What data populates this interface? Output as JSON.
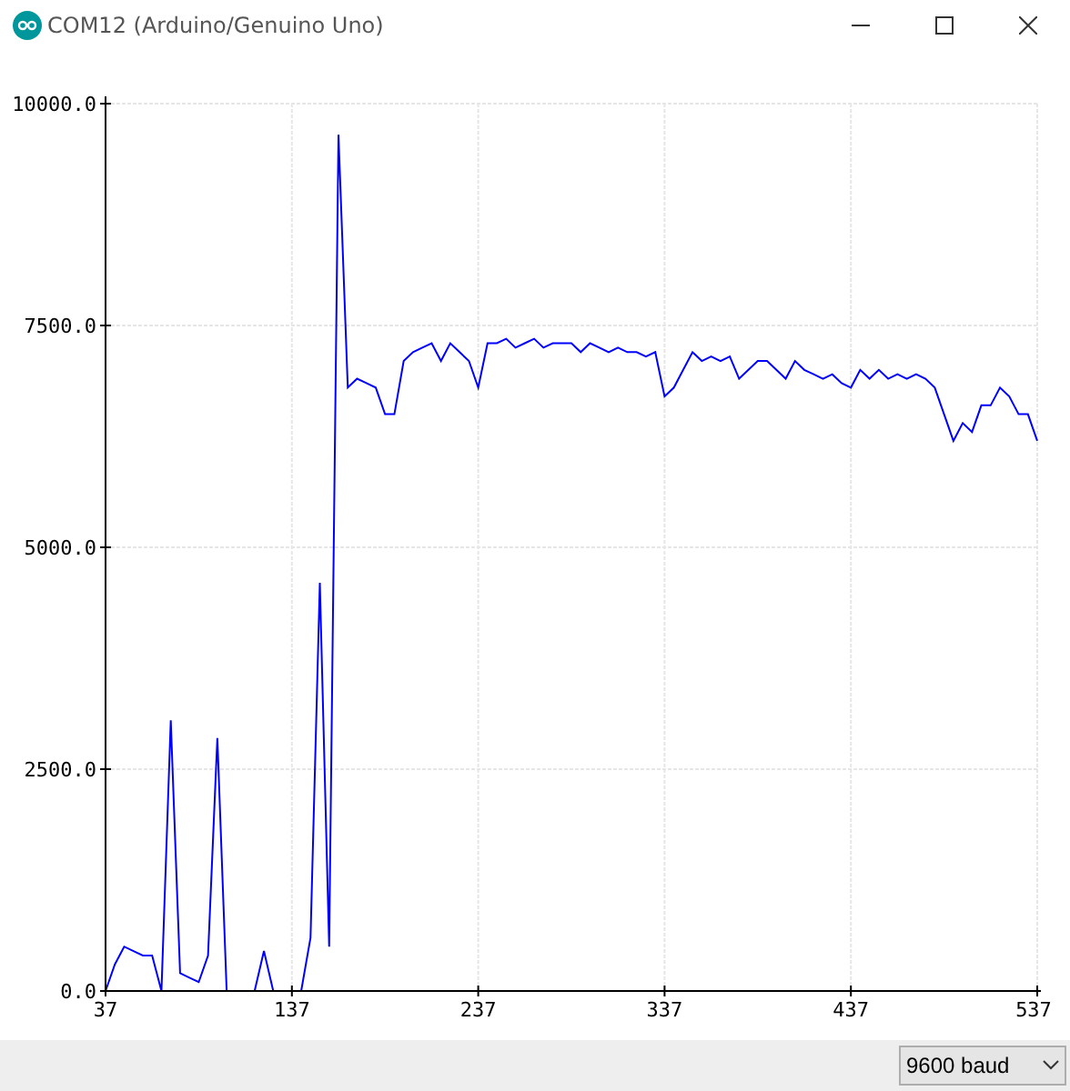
{
  "window": {
    "title": "COM12 (Arduino/Genuino Uno)"
  },
  "plot": {
    "chart_data": {
      "type": "line",
      "x": [
        37,
        42,
        47,
        52,
        57,
        62,
        67,
        72,
        77,
        82,
        87,
        92,
        97,
        102,
        107,
        112,
        117,
        122,
        127,
        132,
        137,
        142,
        147,
        152,
        157,
        162,
        167,
        172,
        177,
        182,
        187,
        192,
        197,
        202,
        207,
        212,
        217,
        222,
        227,
        232,
        237,
        242,
        247,
        252,
        257,
        262,
        267,
        272,
        277,
        282,
        287,
        292,
        297,
        302,
        307,
        312,
        317,
        322,
        327,
        332,
        337,
        342,
        347,
        352,
        357,
        362,
        367,
        372,
        377,
        382,
        387,
        392,
        397,
        402,
        407,
        412,
        417,
        422,
        427,
        432,
        437,
        442,
        447,
        452,
        457,
        462,
        467,
        472,
        477,
        482,
        487,
        492,
        497,
        502,
        507,
        512,
        517,
        522,
        527,
        532,
        537
      ],
      "grid": true,
      "series": [
        {
          "color": "#0000ff",
          "values": [
            0,
            300,
            500,
            450,
            400,
            400,
            0,
            3050,
            200,
            150,
            100,
            400,
            2850,
            0,
            0,
            0,
            0,
            450,
            0,
            0,
            0,
            0,
            600,
            4600,
            500,
            9650,
            6800,
            6900,
            6850,
            6800,
            6500,
            6500,
            7100,
            7200,
            7250,
            7300,
            7100,
            7300,
            7200,
            7100,
            6800,
            7300,
            7300,
            7350,
            7250,
            7300,
            7350,
            7250,
            7300,
            7300,
            7300,
            7200,
            7300,
            7250,
            7200,
            7250,
            7200,
            7200,
            7150,
            7200,
            6700,
            6800,
            7000,
            7200,
            7100,
            7150,
            7100,
            7150,
            6900,
            7000,
            7100,
            7100,
            7000,
            6900,
            7100,
            7000,
            6950,
            6900,
            6950,
            6850,
            6800,
            7000,
            6900,
            7000,
            6900,
            6950,
            6900,
            6950,
            6900,
            6800,
            6500,
            6200,
            6400,
            6300,
            6600,
            6600,
            6800,
            6700,
            6500,
            6500,
            6200
          ]
        }
      ],
      "xlim": [
        37,
        537
      ],
      "ylim": [
        0,
        10000
      ],
      "xticks": [
        37,
        137,
        237,
        337,
        437,
        537
      ],
      "yticks": [
        {
          "value": 0,
          "label": "0.0"
        },
        {
          "value": 2500,
          "label": "2500.0"
        },
        {
          "value": 5000,
          "label": "5000.0"
        },
        {
          "value": 7500,
          "label": "7500.0"
        },
        {
          "value": 10000,
          "label": "10000.0"
        }
      ]
    }
  },
  "footer": {
    "baud_rate": {
      "value": "9600 baud"
    }
  }
}
